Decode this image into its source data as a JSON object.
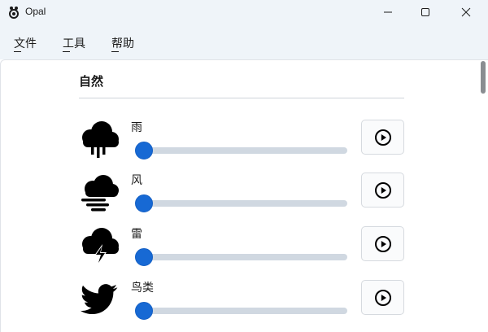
{
  "window": {
    "title": "Opal",
    "icon": "opal-app-icon",
    "controls": [
      "minimize-icon",
      "maximize-icon",
      "close-icon"
    ]
  },
  "menu": {
    "items": [
      {
        "label": "文件"
      },
      {
        "label": "工具"
      },
      {
        "label": "帮助"
      }
    ]
  },
  "section": {
    "title": "自然"
  },
  "sounds": [
    {
      "label": "雨",
      "icon": "rain-cloud-icon",
      "volume": 0.0,
      "action_icon": "play-circle-icon"
    },
    {
      "label": "风",
      "icon": "wind-cloud-icon",
      "volume": 0.0,
      "action_icon": "play-circle-icon"
    },
    {
      "label": "雷",
      "icon": "thunder-cloud-icon",
      "volume": 0.0,
      "action_icon": "play-circle-icon"
    },
    {
      "label": "鸟类",
      "icon": "bird-icon",
      "volume": 0.0,
      "action_icon": "play-circle-icon"
    }
  ],
  "colors": {
    "accent": "#1769d4",
    "track": "#d0d8e1",
    "chrome": "#eff4f9"
  }
}
